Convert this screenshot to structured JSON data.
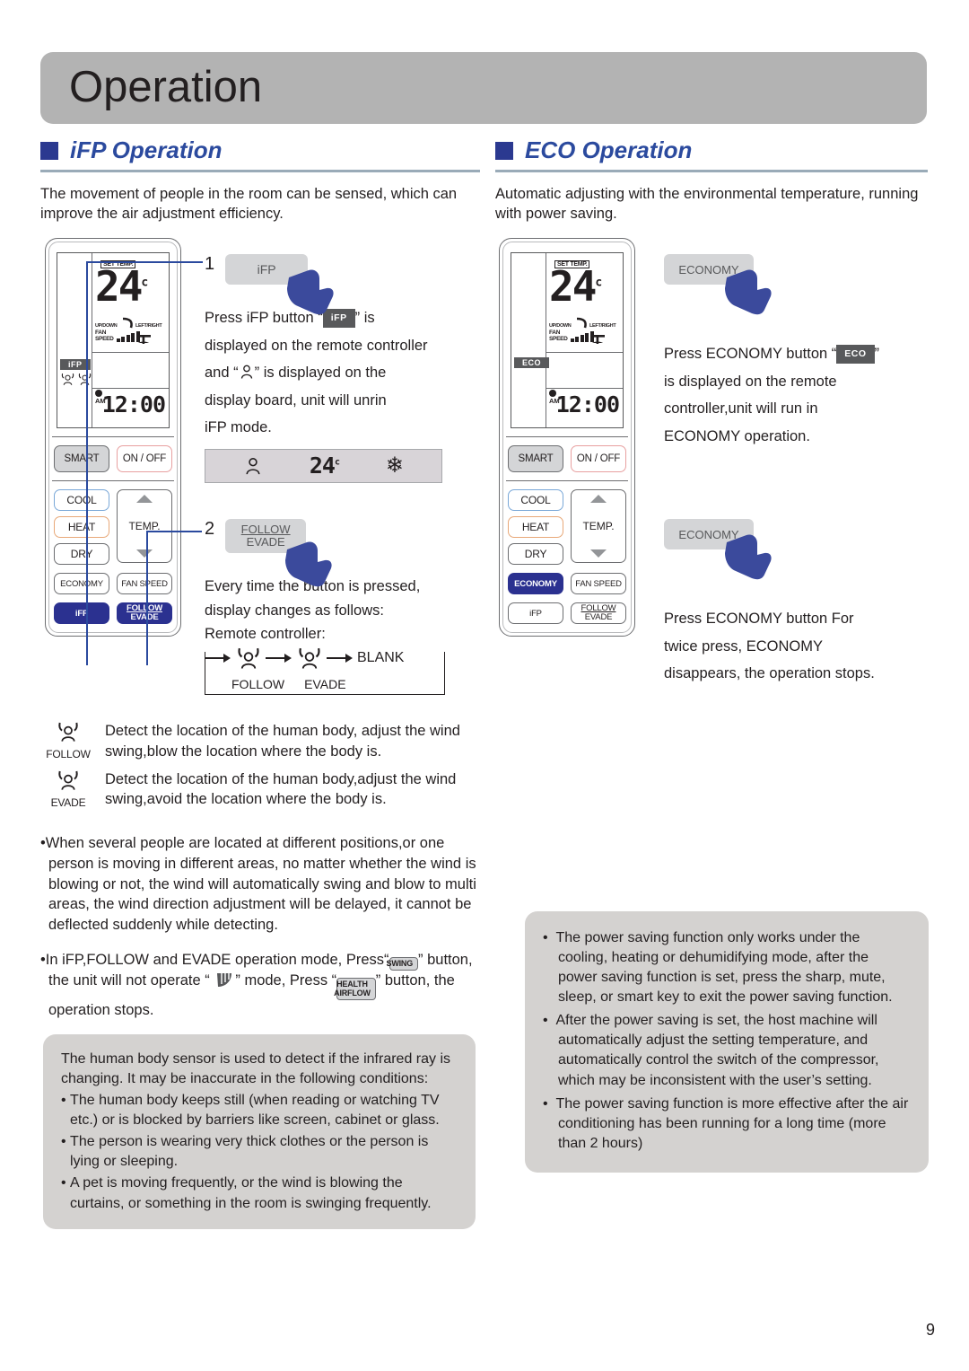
{
  "page": {
    "banner_title": "Operation",
    "page_number": "9"
  },
  "left": {
    "section_title": "iFP Operation",
    "intro": "The movement of people in the room can be sensed, which can improve the air adjustment efficiency.",
    "remote": {
      "lcd": {
        "set_temp_label": "SET TEMP.",
        "temperature": "24",
        "temp_unit": "c",
        "updown_label": "UP/DOWN",
        "leftright_label": "LEFT/RIGHT",
        "fan_label_line1": "FAN",
        "fan_label_line2": "SPEED",
        "mode_tag": "iFP",
        "am_label": "AM",
        "clock": "12:00"
      },
      "buttons": {
        "smart": "SMART",
        "on_off": "ON / OFF",
        "cool": "COOL",
        "heat": "HEAT",
        "dry": "DRY",
        "temp": "TEMP.",
        "economy": "ECONOMY",
        "fan_speed": "FAN SPEED",
        "ifp": "iFP",
        "follow": "FOLLOW",
        "evade": "EVADE"
      },
      "highlighted": [
        "iFP",
        "FOLLOW/EVADE"
      ]
    },
    "step1": {
      "number": "1",
      "key_label": "iFP",
      "text_a": "Press iFP button “",
      "tag": "iFP",
      "text_b": "” is",
      "line2": "displayed on the remote controller",
      "line3_a": "and “",
      "line3_b": "” is displayed on the",
      "line4": "display board, unit will unrin",
      "line5": "iFP mode.",
      "board": {
        "temperature": "24",
        "unit": "c",
        "snow_icon": "snowflake-icon",
        "person_icon": "person-icon"
      }
    },
    "step2": {
      "number": "2",
      "key_line1": "FOLLOW",
      "key_line2": "EVADE",
      "line1": "Every time the button is pressed,",
      "line2": "display changes as follows:",
      "line3": "Remote controller:",
      "flow": {
        "item1": "FOLLOW",
        "item2": "EVADE",
        "item3": "BLANK"
      }
    },
    "legend": [
      {
        "icon_label": "FOLLOW",
        "text": "Detect the location of the human body, adjust the wind swing,blow the location where the body is."
      },
      {
        "icon_label": "EVADE",
        "text": "Detect the location of the human body,adjust the wind swing,avoid the location where the body is."
      }
    ],
    "bullets": [
      "When several people are located at different positions,or one person is moving in different areas, no matter whether the wind is blowing or not, the wind will automatically swing and blow to multi areas, the wind direction adjustment will be delayed, it cannot be deflected suddenly while detecting.",
      "In iFP,FOLLOW and EVADE operation mode, Press“"
    ],
    "bullet2": {
      "prefix": "In iFP,FOLLOW and EVADE operation mode, Press“",
      "swing_btn": "SWING",
      "mid": "” button, the unit will not operate “",
      "mid2": "” mode, Press “",
      "health_btn_line1": "HEALTH",
      "health_btn_line2": "AIRFLOW",
      "suffix": "” button, the operation stops."
    },
    "note": {
      "intro": "The human body sensor is used to detect if the infrared ray is changing. It may be inaccurate in the following conditions:",
      "items": [
        "The human body keeps still (when reading or watching TV etc.) or is blocked by barriers like screen, cabinet or glass.",
        "The person is wearing very thick clothes or the person is lying or sleeping.",
        "A pet is moving frequently, or the wind is blowing the curtains, or something in the room is swinging frequently."
      ]
    }
  },
  "right": {
    "section_title": "ECO Operation",
    "intro": "Automatic adjusting with the environmental temperature, running with power saving.",
    "remote": {
      "lcd": {
        "set_temp_label": "SET TEMP.",
        "temperature": "24",
        "temp_unit": "c",
        "updown_label": "UP/DOWN",
        "leftright_label": "LEFT/RIGHT",
        "fan_label_line1": "FAN",
        "fan_label_line2": "SPEED",
        "mode_tag": "ECO",
        "am_label": "AM",
        "clock": "12:00"
      },
      "buttons": {
        "smart": "SMART",
        "on_off": "ON / OFF",
        "cool": "COOL",
        "heat": "HEAT",
        "dry": "DRY",
        "temp": "TEMP.",
        "economy": "ECONOMY",
        "fan_speed": "FAN SPEED",
        "ifp": "iFP",
        "follow": "FOLLOW",
        "evade": "EVADE"
      },
      "highlighted": [
        "ECONOMY"
      ]
    },
    "step1": {
      "key_label": "ECONOMY",
      "text_a": "Press ECONOMY button “",
      "tag": "ECO",
      "text_b": "”",
      "line2": "is displayed on the remote",
      "line3": "controller,unit will run in",
      "line4": "ECONOMY operation."
    },
    "step2": {
      "key_label": "ECONOMY",
      "line1": "Press ECONOMY button For",
      "line2": "twice press, ECONOMY",
      "line3": "disappears, the operation stops."
    },
    "note": {
      "items": [
        "The power saving function only works under the cooling, heating or dehumidifying mode, after the power saving function is set, press the sharp, mute, sleep, or smart key to exit the power saving function.",
        "After the power saving is set, the host machine will automatically adjust the setting temperature, and automatically control the switch of the compressor, which may be inconsistent with the user’s setting.",
        "The power saving function is more effective after the air conditioning has been running for a long time (more than 2 hours)"
      ]
    }
  },
  "colors": {
    "brand_blue": "#2b3990",
    "heading_blue": "#2b4a9e",
    "banner_gray": "#b3b3b3",
    "note_gray": "#d4d2d0",
    "key_gray": "#d4d5d7",
    "tag_gray": "#58595b"
  }
}
